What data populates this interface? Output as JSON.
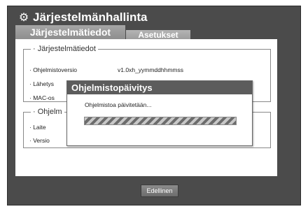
{
  "window": {
    "title": "Järjestelmänhallinta",
    "icon": "gear-icon"
  },
  "tabs": [
    {
      "label": "Järjestelmätiedot",
      "active": true
    },
    {
      "label": "Asetukset",
      "active": false
    }
  ],
  "system_info": {
    "legend": "Järjestelmätiedot",
    "rows": [
      {
        "label": "· Ohjelmistoversio",
        "value": "v1.0xh_yymmddhhmmss"
      },
      {
        "label": "· Lähetys",
        "value": ""
      },
      {
        "label": "· MAC-os",
        "value": ""
      }
    ]
  },
  "device_info": {
    "legend": "Ohjelm",
    "rows": [
      {
        "label": "· Laite"
      },
      {
        "label": "· Versio"
      }
    ]
  },
  "dialog": {
    "title": "Ohjelmistopäivitys",
    "message": "Ohjelmistoa päivitetään..."
  },
  "footer": {
    "back_label": "Edellinen"
  },
  "colors": {
    "frame": "#4b4b4b",
    "tab_active": "#9a9a9a",
    "dialog_header": "#5c5c5c"
  }
}
